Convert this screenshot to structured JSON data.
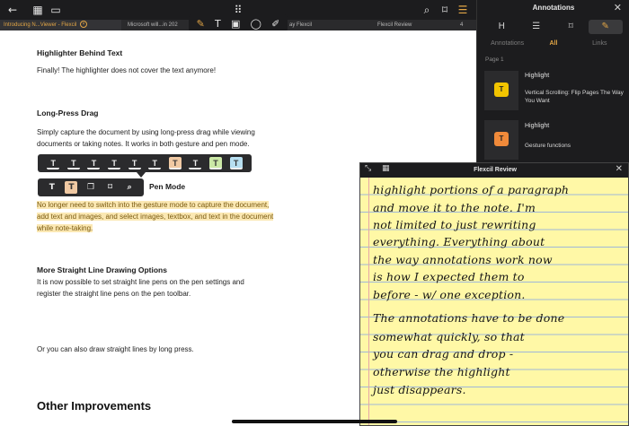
{
  "topbar": {
    "icons": {
      "back": "back-arrow-icon",
      "grid": "grid-icon",
      "doc": "document-icon",
      "apps": "apps-grid-icon",
      "search": "search-icon",
      "bookmark": "bookmark-icon",
      "list": "list-icon"
    },
    "toolbar_tools": [
      "✎",
      "T",
      "▣",
      "◯",
      "✐"
    ]
  },
  "tabs": [
    {
      "label": "Introducing N...Viewer - Flexcil",
      "active": true
    },
    {
      "label": "Microsoft will...in 202",
      "active": false
    },
    {
      "label": "ay Flexcil",
      "active": false
    },
    {
      "label": "Flexcil Review",
      "active": false
    },
    {
      "label": "4",
      "active": false
    }
  ],
  "document": {
    "h1": "Highlighter Behind Text",
    "p1": "Finally! The highlighter does not cover the text anymore!",
    "h2": "Long-Press Drag",
    "p2": "Simply capture the document by using long-press drag while viewing documents or taking notes. It works in both gesture and pen mode.",
    "h3_partial": "Pen Mode",
    "p3_highlighted": "No longer need to switch into the gesture mode to capture the document, add text and images, and select images, textbox, and text in the document while note-taking.",
    "h4": "More Straight Line Drawing Options",
    "p4": "It is now possible to set straight line pens on the pen settings and register the straight line pens on the pen toolbar.",
    "p5": "Or you can also draw straight lines by long press.",
    "h5": "Other Improvements"
  },
  "highlight_popup": {
    "letters": [
      "T",
      "T",
      "T",
      "T",
      "T",
      "T",
      "T",
      "T",
      "T",
      "T"
    ],
    "colors": [
      "none",
      "none",
      "none",
      "none",
      "none",
      "none",
      "#f0c9a3",
      "none",
      "#cbe8a6",
      "#b7dff1"
    ]
  },
  "action_popup": {
    "items": [
      {
        "name": "text-style-icon",
        "glyph": "T"
      },
      {
        "name": "highlight-color-icon",
        "glyph": "T"
      },
      {
        "name": "copy-icon",
        "glyph": "❐"
      },
      {
        "name": "bookmark-icon",
        "glyph": "⌑"
      },
      {
        "name": "search-icon",
        "glyph": "⌕"
      }
    ]
  },
  "panel": {
    "title": "Annotations",
    "segments": [
      "H",
      "☰",
      "⌑",
      "✎"
    ],
    "filters": [
      "Annotations",
      "All",
      "Links"
    ],
    "page_label": "Page 1",
    "items": [
      {
        "type": "Highlight",
        "text": "",
        "swatch": "#f2c400"
      },
      {
        "type": "",
        "text": "Vertical Scrolling: Flip Pages The Way You Want",
        "swatch": ""
      },
      {
        "type": "Highlight",
        "text": "",
        "swatch": "#f08a3a"
      },
      {
        "type": "",
        "text": "Gesture functions",
        "swatch": ""
      }
    ]
  },
  "note": {
    "title": "Flexcil Review",
    "handwriting": [
      "highlight portions of a paragraph",
      "and move it to the note. I'm",
      "not limited to just rewriting",
      "everything. Everything about",
      "the way annotations work now",
      "is how I expected them to",
      "before - w/ one exception.",
      "The annotations have to be done",
      "somewhat quickly, so that",
      "you can drag and drop -",
      "otherwise the highlight",
      "just disappears."
    ]
  }
}
